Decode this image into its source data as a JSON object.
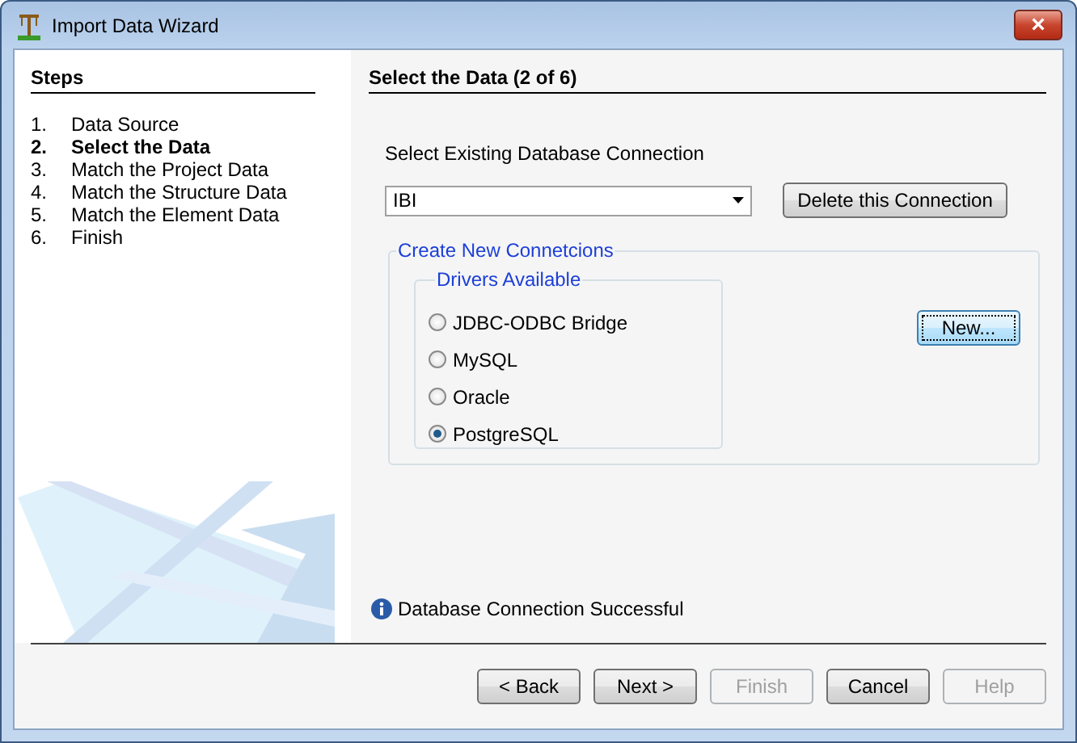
{
  "window": {
    "title": "Import Data Wizard",
    "close": "×"
  },
  "steps": {
    "title": "Steps",
    "items": [
      {
        "number": "1.",
        "label": "Data Source",
        "current": false
      },
      {
        "number": "2.",
        "label": "Select the Data",
        "current": true
      },
      {
        "number": "3.",
        "label": "Match the Project Data",
        "current": false
      },
      {
        "number": "4.",
        "label": "Match the Structure Data",
        "current": false
      },
      {
        "number": "5.",
        "label": "Match the Element Data",
        "current": false
      },
      {
        "number": "6.",
        "label": "Finish",
        "current": false
      }
    ]
  },
  "page": {
    "title": "Select the Data (2 of 6)",
    "connection_label": "Select Existing Database Connection",
    "connection": {
      "value": "IBI"
    },
    "delete_button": "Delete this Connection",
    "create_group": {
      "title": "Create New Connetcions",
      "drivers_group": {
        "title": "Drivers Available",
        "options": [
          {
            "label": "JDBC-ODBC Bridge",
            "selected": false
          },
          {
            "label": "MySQL",
            "selected": false
          },
          {
            "label": "Oracle",
            "selected": false
          },
          {
            "label": "PostgreSQL",
            "selected": true
          }
        ]
      },
      "new_button": "New..."
    },
    "status": "Database Connection Successful"
  },
  "buttons": [
    {
      "label": "< Back",
      "disabled": false
    },
    {
      "label": "Next >",
      "disabled": false
    },
    {
      "label": "Finish",
      "disabled": true
    },
    {
      "label": "Cancel",
      "disabled": false
    },
    {
      "label": "Help",
      "disabled": true
    }
  ]
}
